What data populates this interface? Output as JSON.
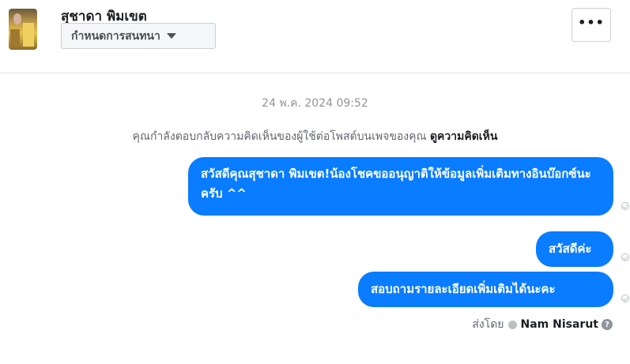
{
  "header": {
    "contact_name": "สุชาดา พิมเขต",
    "assign_label": "กำหนดการสนทนา",
    "more_label": "•••"
  },
  "conversation": {
    "timestamp": "24 พ.ค. 2024 09:52",
    "notice_text": "คุณกำลังตอบกลับความคิดเห็นของผู้ใช้ต่อโพสต์บนเพจของคุณ ",
    "notice_link": "ดูความคิดเห็น",
    "messages": [
      {
        "text": "สวัสดีคุณสุชาดา พิมเขต!น้องโชคขออนุญาติให้ข้อมูลเพิ่มเติมทางอินบ๊อกซ์นะครับ ^^"
      },
      {
        "text": "สวัสดีค่ะ"
      },
      {
        "text": "สอบถามรายละเอียดเพิ่มเติมได้นะคะ"
      }
    ],
    "sent_by_label": "ส่งโดย",
    "sent_by_name": "Nam Nisarut",
    "help_glyph": "?"
  },
  "colors": {
    "bubble": "#0a7cff",
    "header_border": "#e4e6eb"
  }
}
